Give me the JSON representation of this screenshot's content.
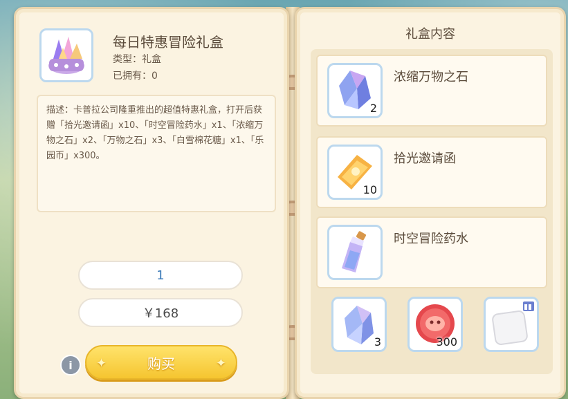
{
  "item": {
    "title": "每日特惠冒险礼盒",
    "type_line": "类型：礼盒",
    "owned_line": "已拥有：0",
    "description": "描述：卡普拉公司隆重推出的超值特惠礼盒，打开后获赠「拾光邀请函」x10、「时空冒险药水」x1、「浓缩万物之石」x2、「万物之石」x3、「白雪棉花糖」x1、「乐园币」x300。"
  },
  "purchase": {
    "quantity": "1",
    "price": "￥168",
    "buy_label": "购买",
    "info_label": "i"
  },
  "contents": {
    "title": "礼盒内容",
    "rows": [
      {
        "name": "浓缩万物之石",
        "count": "2",
        "icon": "crystal-icon"
      },
      {
        "name": "拾光邀请函",
        "count": "10",
        "icon": "ticket-icon"
      },
      {
        "name": "时空冒险药水",
        "count": "",
        "icon": "potion-icon"
      }
    ],
    "small": [
      {
        "count": "3",
        "icon": "crystal-shard-icon"
      },
      {
        "count": "300",
        "icon": "park-coin-icon"
      },
      {
        "count": "",
        "icon": "marshmallow-icon"
      }
    ]
  },
  "colors": {
    "accent": "#f5c530",
    "frame": "#bcd8ee",
    "paper": "#fbf3e1"
  }
}
